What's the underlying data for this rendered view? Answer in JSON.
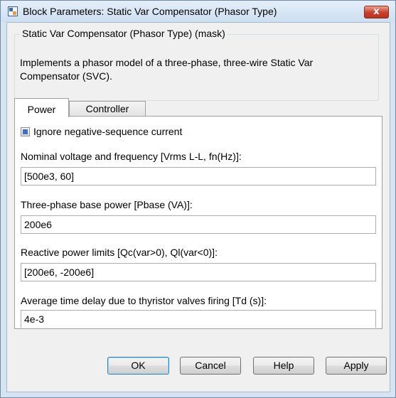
{
  "window": {
    "title": "Block Parameters: Static Var Compensator (Phasor Type)",
    "close_label": "x"
  },
  "mask": {
    "legend": "Static Var Compensator (Phasor Type) (mask)",
    "description": "Implements a phasor model of a three-phase, three-wire Static Var Compensator (SVC)."
  },
  "tabs": [
    {
      "label": "Power",
      "selected": true
    },
    {
      "label": "Controller",
      "selected": false
    }
  ],
  "power": {
    "ignore_negative_sequence": {
      "label": "Ignore negative-sequence current",
      "checked": true
    },
    "fields": [
      {
        "label": "Nominal voltage and frequency [Vrms L-L, fn(Hz)]:",
        "value": "[500e3,  60]"
      },
      {
        "label": "Three-phase base power [Pbase (VA)]:",
        "value": "200e6"
      },
      {
        "label": "Reactive power limits [Qc(var>0), Ql(var<0)]:",
        "value": "[200e6,  -200e6]"
      },
      {
        "label": "Average time delay due to thyristor valves firing [Td (s)]:",
        "value": "4e-3"
      }
    ]
  },
  "buttons": {
    "ok": "OK",
    "cancel": "Cancel",
    "help": "Help",
    "apply": "Apply"
  },
  "colors": {
    "title_bar": "#d6e3f0",
    "close_button": "#c7402b",
    "default_button_border": "#3c7fb1"
  }
}
